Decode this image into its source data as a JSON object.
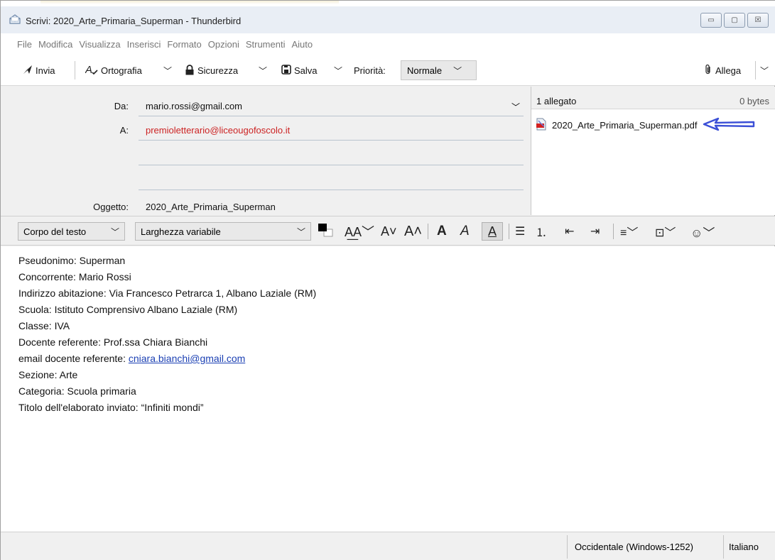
{
  "window": {
    "title": "Scrivi: 2020_Arte_Primaria_Superman - Thunderbird",
    "controls": {
      "minimize": "▭",
      "maximize": "▢",
      "close": "☒"
    }
  },
  "menu": [
    "File",
    "Modifica",
    "Visualizza",
    "Inserisci",
    "Formato",
    "Opzioni",
    "Strumenti",
    "Aiuto"
  ],
  "toolbar": {
    "send_label": "Invia",
    "spelling_label": "Ortografia",
    "security_label": "Sicurezza",
    "save_label": "Salva",
    "priority_label": "Priorità:",
    "priority_value": "Normale",
    "attach_label": "Allega"
  },
  "header": {
    "from_label": "Da:",
    "from_value": "mario.rossi@gmail.com",
    "to_label": "A:",
    "to_value": "premioletterario@liceougofoscolo.it",
    "subject_label": "Oggetto:",
    "subject_value": "2020_Arte_Primaria_Superman"
  },
  "attachments": {
    "count_label": "1 allegato",
    "size_label": "0 bytes",
    "files": [
      "2020_Arte_Primaria_Superman.pdf"
    ]
  },
  "format": {
    "paragraph_style": "Corpo del testo",
    "font": "Larghezza variabile"
  },
  "body": {
    "lines": [
      "Pseudonimo: Superman",
      "Concorrente: Mario Rossi",
      "Indirizzo abitazione: Via Francesco Petrarca 1, Albano Laziale (RM)",
      "Scuola: Istituto Comprensivo Albano Laziale (RM)",
      "Classe: IVA",
      "Docente referente: Prof.ssa Chiara Bianchi",
      "email docente referente: ",
      "Sezione: Arte",
      "Categoria: Scuola primaria",
      "Titolo dell'elaborato inviato: “Infiniti mondi”"
    ],
    "email_link": "cniara.bianchi@gmail.com"
  },
  "status": {
    "encoding": "Occidentale (Windows-1252)",
    "language": "Italiano"
  },
  "colors": {
    "recipient": "#cc2222",
    "link": "#1a3fb3",
    "arrow": "#3b4fd6"
  },
  "icons": [
    "compose-icon",
    "send-icon",
    "spelling-icon",
    "lock-icon",
    "save-icon",
    "paperclip-icon",
    "pdf-icon",
    "arrow-annotation-icon"
  ]
}
